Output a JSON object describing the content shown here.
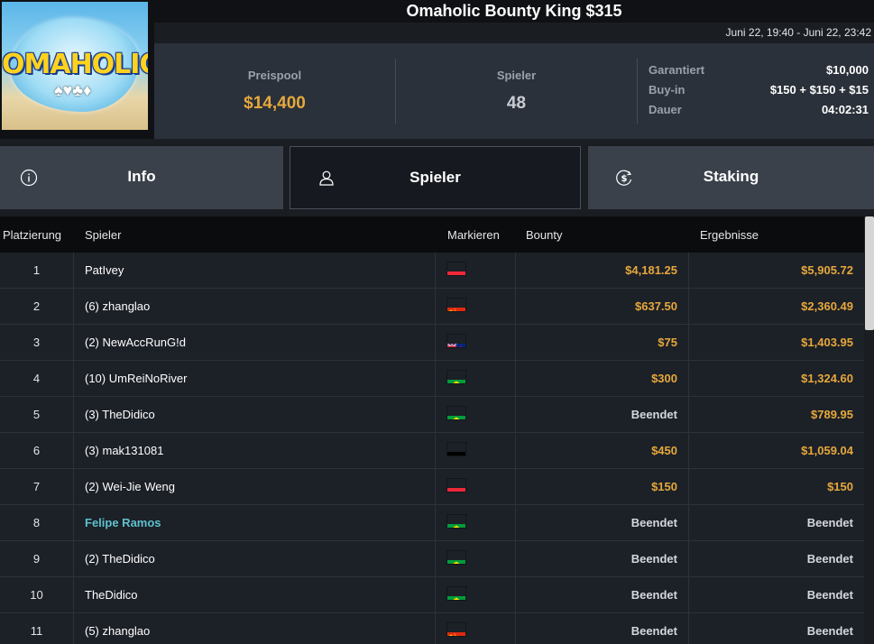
{
  "logo": {
    "text": "OMAHOLIC"
  },
  "title": "Omaholic Bounty King $315",
  "date_range": "Juni 22, 19:40 - Juni 22, 23:42",
  "stats": {
    "prize_pool_label": "Preispool",
    "prize_pool": "$14,400",
    "players_label": "Spieler",
    "players": "48"
  },
  "details": [
    {
      "key": "Garantiert",
      "value": "$10,000"
    },
    {
      "key": "Buy-in",
      "value": "$150 + $150 + $15"
    },
    {
      "key": "Dauer",
      "value": "04:02:31"
    }
  ],
  "tabs": [
    {
      "label": "Info",
      "icon": "info-icon"
    },
    {
      "label": "Spieler",
      "icon": "user-icon",
      "active": true
    },
    {
      "label": "Staking",
      "icon": "dollar-icon"
    }
  ],
  "table": {
    "headers": {
      "place": "Platzierung",
      "player": "Spieler",
      "flag": "Markieren",
      "bounty": "Bounty",
      "result": "Ergebnisse"
    },
    "rows": [
      {
        "place": "1",
        "player": "PatIvey",
        "flag": "austria",
        "bounty": "$4,181.25",
        "result": "$5,905.72"
      },
      {
        "place": "2",
        "player": "(6) zhanglao",
        "flag": "china",
        "bounty": "$637.50",
        "result": "$2,360.49"
      },
      {
        "place": "3",
        "player": "(2) NewAccRunG!d",
        "flag": "new-zealand",
        "bounty": "$75",
        "result": "$1,403.95"
      },
      {
        "place": "4",
        "player": "(10) UmReiNoRiver",
        "flag": "brazil",
        "bounty": "$300",
        "result": "$1,324.60"
      },
      {
        "place": "5",
        "player": "(3) TheDidico",
        "flag": "brazil",
        "bounty": "Beendet",
        "result": "$789.95"
      },
      {
        "place": "6",
        "player": "(3) mak131081",
        "flag": "germany",
        "bounty": "$450",
        "result": "$1,059.04"
      },
      {
        "place": "7",
        "player": "(2) Wei-Jie Weng",
        "flag": "austria",
        "bounty": "$150",
        "result": "$150"
      },
      {
        "place": "8",
        "player": "Felipe Ramos",
        "flag": "brazil",
        "bounty": "Beendet",
        "result": "Beendet",
        "highlight": true
      },
      {
        "place": "9",
        "player": "(2) TheDidico",
        "flag": "brazil",
        "bounty": "Beendet",
        "result": "Beendet"
      },
      {
        "place": "10",
        "player": "TheDidico",
        "flag": "brazil",
        "bounty": "Beendet",
        "result": "Beendet"
      },
      {
        "place": "11",
        "player": "(5) zhanglao",
        "flag": "china",
        "bounty": "Beendet",
        "result": "Beendet"
      }
    ]
  },
  "colors": {
    "accent_money": "#e6a83c",
    "highlight_name": "#5dc1cf",
    "background": "#1a1d22"
  }
}
